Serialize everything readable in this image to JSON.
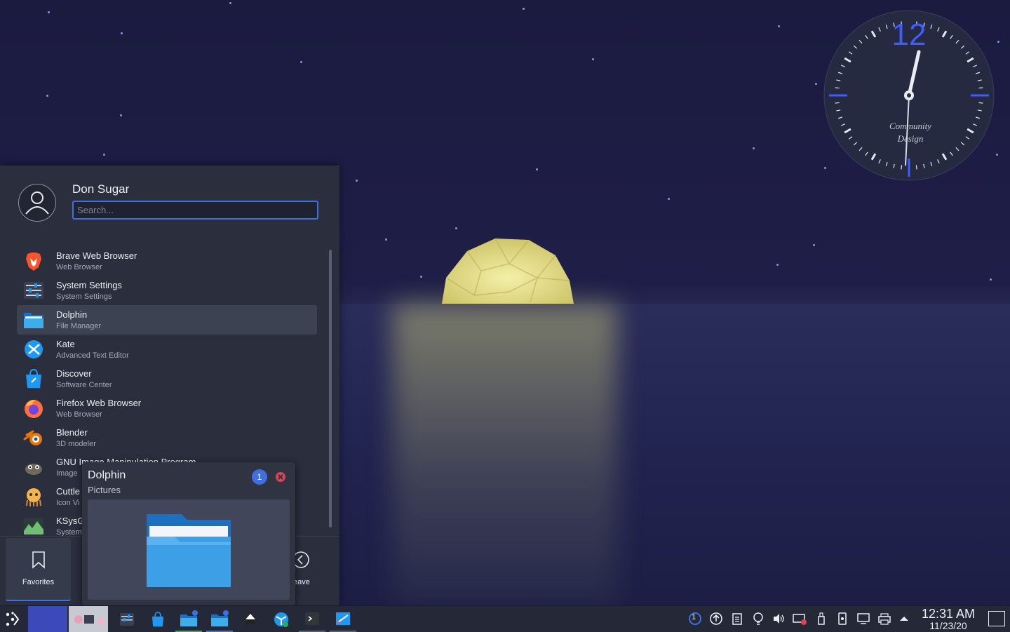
{
  "clock_widget": {
    "numeral": "12",
    "brand_line1": "Community",
    "brand_line2": "Design"
  },
  "launcher": {
    "username": "Don Sugar",
    "search_placeholder": "Search...",
    "apps": [
      {
        "name": "Brave Web Browser",
        "desc": "Web Browser",
        "icon": "brave-icon"
      },
      {
        "name": "System Settings",
        "desc": "System Settings",
        "icon": "settings-icon"
      },
      {
        "name": "Dolphin",
        "desc": "File Manager",
        "icon": "folder-icon",
        "selected": true
      },
      {
        "name": "Kate",
        "desc": "Advanced Text Editor",
        "icon": "kate-icon"
      },
      {
        "name": "Discover",
        "desc": "Software Center",
        "icon": "discover-icon"
      },
      {
        "name": "Firefox Web Browser",
        "desc": "Web Browser",
        "icon": "firefox-icon"
      },
      {
        "name": "Blender",
        "desc": "3D modeler",
        "icon": "blender-icon"
      },
      {
        "name": "GNU Image Manipulation Program",
        "desc": "Image",
        "icon": "gimp-icon"
      },
      {
        "name": "Cuttle",
        "desc": "Icon Vi",
        "icon": "cuttlefish-icon"
      },
      {
        "name": "KSysG",
        "desc": "System",
        "icon": "ksysguard-icon"
      }
    ],
    "tabs": {
      "favorites": "Favorites",
      "leave": "eave"
    }
  },
  "tooltip": {
    "title": "Dolphin",
    "subtitle": "Pictures",
    "badge": "1"
  },
  "taskbar": {
    "pager_badge": "1",
    "time": "12:31 AM",
    "date": "11/23/20"
  },
  "colors": {
    "accent": "#3f6fe0",
    "panel": "#2a2e3d",
    "taskbar": "#242837"
  }
}
